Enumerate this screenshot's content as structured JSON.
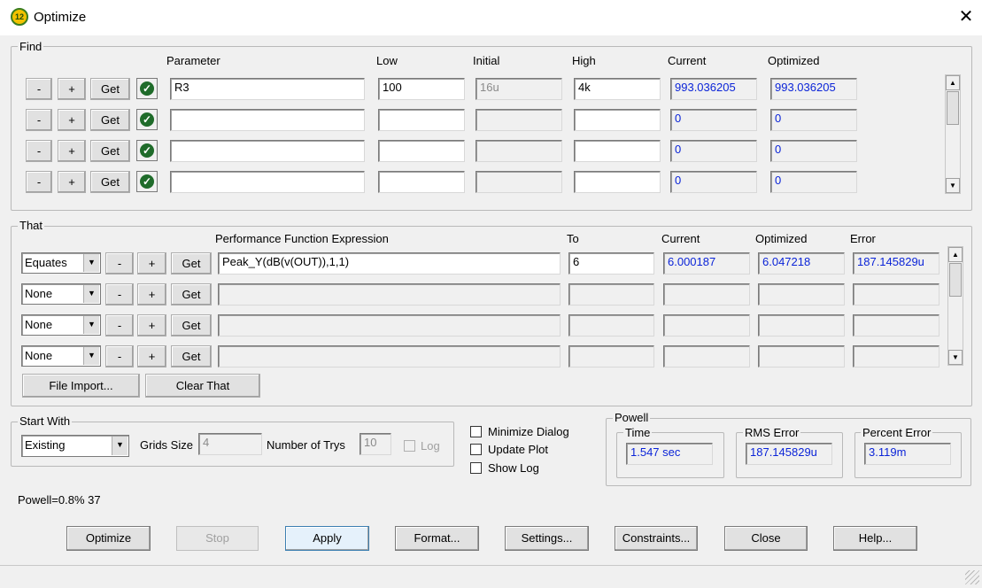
{
  "window": {
    "title": "Optimize",
    "icon_text": "12",
    "close_glyph": "✕"
  },
  "find": {
    "legend": "Find",
    "headers": {
      "parameter": "Parameter",
      "low": "Low",
      "initial": "Initial",
      "high": "High",
      "current": "Current",
      "optimized": "Optimized"
    },
    "row_buttons": {
      "minus": "-",
      "plus": "+",
      "get": "Get"
    },
    "rows": [
      {
        "parameter": "R3",
        "low": "100",
        "initial": "16u",
        "high": "4k",
        "current": "993.036205",
        "optimized": "993.036205"
      },
      {
        "parameter": "",
        "low": "",
        "initial": "",
        "high": "",
        "current": "0",
        "optimized": "0"
      },
      {
        "parameter": "",
        "low": "",
        "initial": "",
        "high": "",
        "current": "0",
        "optimized": "0"
      },
      {
        "parameter": "",
        "low": "",
        "initial": "",
        "high": "",
        "current": "0",
        "optimized": "0"
      }
    ]
  },
  "that": {
    "legend": "That",
    "headers": {
      "expression": "Performance Function Expression",
      "to": "To",
      "current": "Current",
      "optimized": "Optimized",
      "error": "Error"
    },
    "row_buttons": {
      "minus": "-",
      "plus": "+",
      "get": "Get"
    },
    "rows": [
      {
        "mode": "Equates",
        "expression": "Peak_Y(dB(v(OUT)),1,1)",
        "to": "6",
        "current": "6.000187",
        "optimized": "6.047218",
        "error": "187.145829u"
      },
      {
        "mode": "None",
        "expression": "",
        "to": "",
        "current": "",
        "optimized": "",
        "error": ""
      },
      {
        "mode": "None",
        "expression": "",
        "to": "",
        "current": "",
        "optimized": "",
        "error": ""
      },
      {
        "mode": "None",
        "expression": "",
        "to": "",
        "current": "",
        "optimized": "",
        "error": ""
      }
    ],
    "file_import": "File Import...",
    "clear_that": "Clear That"
  },
  "start_with": {
    "legend": "Start With",
    "selected": "Existing",
    "grids_size_label": "Grids Size",
    "grids_size_value": "4",
    "number_of_trys_label": "Number of Trys",
    "number_of_trys_value": "10",
    "log_label": "Log"
  },
  "options": {
    "minimize_dialog": "Minimize Dialog",
    "update_plot": "Update Plot",
    "show_log": "Show Log"
  },
  "powell": {
    "legend": "Powell",
    "time_label": "Time",
    "time_value": "1.547 sec",
    "rms_label": "RMS Error",
    "rms_value": "187.145829u",
    "percent_label": "Percent Error",
    "percent_value": "3.119m"
  },
  "status_text": "Powell=0.8% 37",
  "buttons": {
    "optimize": "Optimize",
    "stop": "Stop",
    "apply": "Apply",
    "format": "Format...",
    "settings": "Settings...",
    "constraints": "Constraints...",
    "close": "Close",
    "help": "Help..."
  },
  "icons": {
    "check": "check-circle-icon",
    "dropdown": "chevron-down-icon",
    "scroll_up": "scroll-up-icon",
    "scroll_down": "scroll-down-icon"
  },
  "colors": {
    "value_text": "#0b24d8",
    "check_green": "#1f6b2a",
    "default_button_border": "#3c7fb1"
  }
}
